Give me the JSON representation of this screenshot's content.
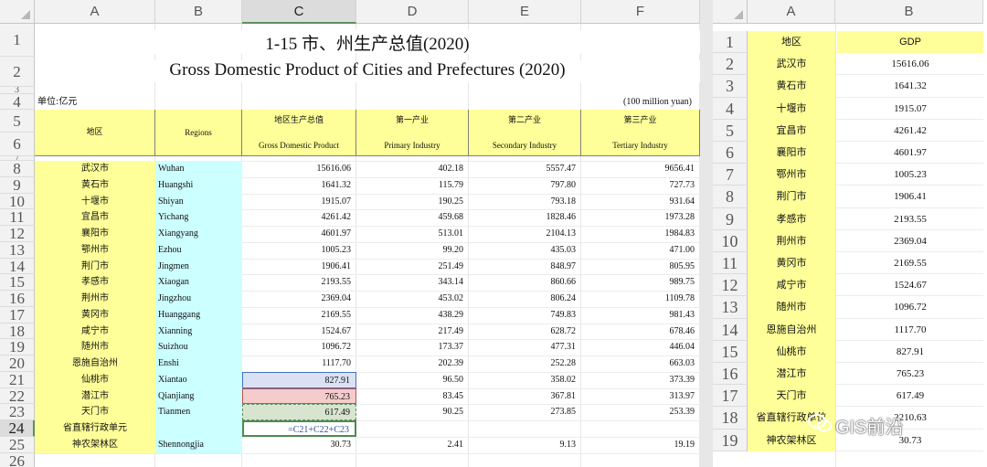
{
  "left_sheet": {
    "columns": [
      "A",
      "B",
      "C",
      "D",
      "E",
      "F"
    ],
    "title_cn": "1-15  市、州生产总值(2020)",
    "title_en": "Gross Domestic Product of Cities and Prefectures (2020)",
    "unit_cn": "单位:亿元",
    "unit_en": "(100 million yuan)",
    "header": {
      "region_cn": "地区",
      "region_en": "Regions",
      "gdp_cn": "地区生产总值",
      "gdp_en": "Gross Domestic Product",
      "primary_cn": "第一产业",
      "primary_en": "Primary Industry",
      "secondary_cn": "第二产业",
      "secondary_en": "Secondary Industry",
      "tertiary_cn": "第三产业",
      "tertiary_en": "Tertiary Industry"
    },
    "row_numbers": [
      "1",
      "2",
      "3",
      "4",
      "5",
      "6",
      "7",
      "8",
      "9",
      "10",
      "11",
      "12",
      "13",
      "14",
      "15",
      "16",
      "17",
      "18",
      "19",
      "20",
      "21",
      "22",
      "23",
      "24",
      "25",
      "26"
    ],
    "rows": [
      {
        "cn": "武汉市",
        "en": "Wuhan",
        "gdp": "15616.06",
        "p": "402.18",
        "s": "5557.47",
        "t": "9656.41"
      },
      {
        "cn": "黄石市",
        "en": "Huangshi",
        "gdp": "1641.32",
        "p": "115.79",
        "s": "797.80",
        "t": "727.73"
      },
      {
        "cn": "十堰市",
        "en": "Shiyan",
        "gdp": "1915.07",
        "p": "190.25",
        "s": "793.18",
        "t": "931.64"
      },
      {
        "cn": "宜昌市",
        "en": "Yichang",
        "gdp": "4261.42",
        "p": "459.68",
        "s": "1828.46",
        "t": "1973.28"
      },
      {
        "cn": "襄阳市",
        "en": "Xiangyang",
        "gdp": "4601.97",
        "p": "513.01",
        "s": "2104.13",
        "t": "1984.83"
      },
      {
        "cn": "鄂州市",
        "en": "Ezhou",
        "gdp": "1005.23",
        "p": "99.20",
        "s": "435.03",
        "t": "471.00"
      },
      {
        "cn": "荆门市",
        "en": "Jingmen",
        "gdp": "1906.41",
        "p": "251.49",
        "s": "848.97",
        "t": "805.95"
      },
      {
        "cn": "孝感市",
        "en": "Xiaogan",
        "gdp": "2193.55",
        "p": "343.14",
        "s": "860.66",
        "t": "989.75"
      },
      {
        "cn": "荆州市",
        "en": "Jingzhou",
        "gdp": "2369.04",
        "p": "453.02",
        "s": "806.24",
        "t": "1109.78"
      },
      {
        "cn": "黄冈市",
        "en": "Huanggang",
        "gdp": "2169.55",
        "p": "438.29",
        "s": "749.83",
        "t": "981.43"
      },
      {
        "cn": "咸宁市",
        "en": "Xianning",
        "gdp": "1524.67",
        "p": "217.49",
        "s": "628.72",
        "t": "678.46"
      },
      {
        "cn": "随州市",
        "en": "Suizhou",
        "gdp": "1096.72",
        "p": "173.37",
        "s": "477.31",
        "t": "446.04"
      },
      {
        "cn": "恩施自治州",
        "en": "Enshi",
        "gdp": "1117.70",
        "p": "202.39",
        "s": "252.28",
        "t": "663.03"
      },
      {
        "cn": "仙桃市",
        "en": "Xiantao",
        "gdp": "827.91",
        "p": "96.50",
        "s": "358.02",
        "t": "373.39"
      },
      {
        "cn": "潜江市",
        "en": "Qianjiang",
        "gdp": "765.23",
        "p": "83.45",
        "s": "367.81",
        "t": "313.97"
      },
      {
        "cn": "天门市",
        "en": "Tianmen",
        "gdp": "617.49",
        "p": "90.25",
        "s": "273.85",
        "t": "253.39"
      },
      {
        "cn": "省直辖行政单元",
        "en": "",
        "gdp": "=C21+C22+C23",
        "p": "",
        "s": "",
        "t": ""
      },
      {
        "cn": "神农架林区",
        "en": "Shennongjia",
        "gdp": "30.73",
        "p": "2.41",
        "s": "9.13",
        "t": "19.19"
      }
    ]
  },
  "right_sheet": {
    "columns": [
      "A",
      "B"
    ],
    "header_region": "地区",
    "header_gdp": "GDP",
    "rows": [
      {
        "n": "2",
        "cn": "武汉市",
        "gdp": "15616.06"
      },
      {
        "n": "3",
        "cn": "黄石市",
        "gdp": "1641.32"
      },
      {
        "n": "4",
        "cn": "十堰市",
        "gdp": "1915.07"
      },
      {
        "n": "5",
        "cn": "宜昌市",
        "gdp": "4261.42"
      },
      {
        "n": "6",
        "cn": "襄阳市",
        "gdp": "4601.97"
      },
      {
        "n": "7",
        "cn": "鄂州市",
        "gdp": "1005.23"
      },
      {
        "n": "8",
        "cn": "荆门市",
        "gdp": "1906.41"
      },
      {
        "n": "9",
        "cn": "孝感市",
        "gdp": "2193.55"
      },
      {
        "n": "10",
        "cn": "荆州市",
        "gdp": "2369.04"
      },
      {
        "n": "11",
        "cn": "黄冈市",
        "gdp": "2169.55"
      },
      {
        "n": "12",
        "cn": "咸宁市",
        "gdp": "1524.67"
      },
      {
        "n": "13",
        "cn": "随州市",
        "gdp": "1096.72"
      },
      {
        "n": "14",
        "cn": "恩施自治州",
        "gdp": "1117.70"
      },
      {
        "n": "15",
        "cn": "仙桃市",
        "gdp": "827.91"
      },
      {
        "n": "16",
        "cn": "潜江市",
        "gdp": "765.23"
      },
      {
        "n": "17",
        "cn": "天门市",
        "gdp": "617.49"
      },
      {
        "n": "18",
        "cn": "省直辖行政单位",
        "gdp": "2210.63"
      },
      {
        "n": "19",
        "cn": "神农架林区",
        "gdp": "30.73"
      }
    ],
    "row1": "1"
  },
  "watermark": "GIS前沿"
}
